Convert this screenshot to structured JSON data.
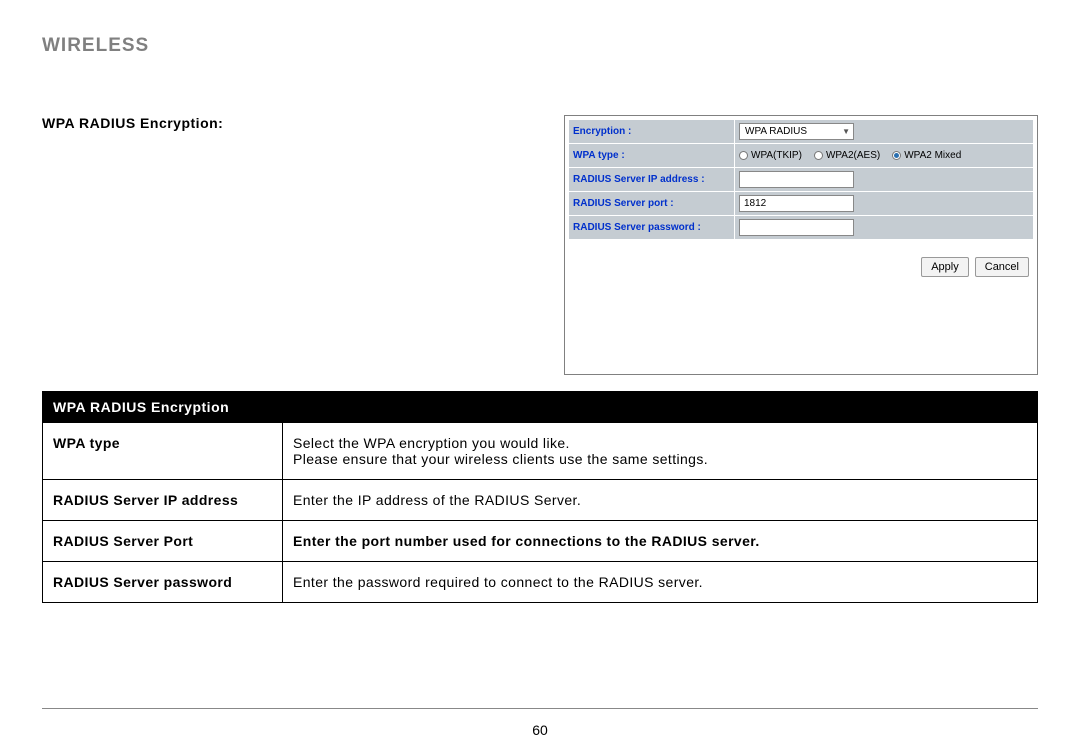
{
  "page": {
    "title": "WIRELESS",
    "section_label": "WPA RADIUS Encryption:",
    "page_number": "60"
  },
  "config": {
    "rows": {
      "encryption": {
        "label": "Encryption :",
        "value": "WPA RADIUS"
      },
      "wpa_type": {
        "label": "WPA type :",
        "options": [
          {
            "label": "WPA(TKIP)",
            "selected": false
          },
          {
            "label": "WPA2(AES)",
            "selected": false
          },
          {
            "label": "WPA2 Mixed",
            "selected": true
          }
        ]
      },
      "radius_ip": {
        "label": "RADIUS Server IP address :",
        "value": ""
      },
      "radius_port": {
        "label": "RADIUS Server port :",
        "value": "1812"
      },
      "radius_password": {
        "label": "RADIUS Server password :",
        "value": ""
      }
    },
    "buttons": {
      "apply": "Apply",
      "cancel": "Cancel"
    }
  },
  "table": {
    "header": "WPA RADIUS Encryption",
    "rows": [
      {
        "name": "WPA type",
        "desc": "Select the WPA encryption you would like.\nPlease ensure that your wireless clients use the same settings.",
        "bold": false
      },
      {
        "name": "RADIUS Server IP address",
        "desc": "Enter the IP address of the RADIUS Server.",
        "bold": false
      },
      {
        "name": "RADIUS Server Port",
        "desc": "Enter the port number used for connections to the RADIUS server.",
        "bold": true
      },
      {
        "name": "RADIUS Server password",
        "desc": "Enter the password required to connect to the RADIUS server.",
        "bold": false
      }
    ]
  }
}
